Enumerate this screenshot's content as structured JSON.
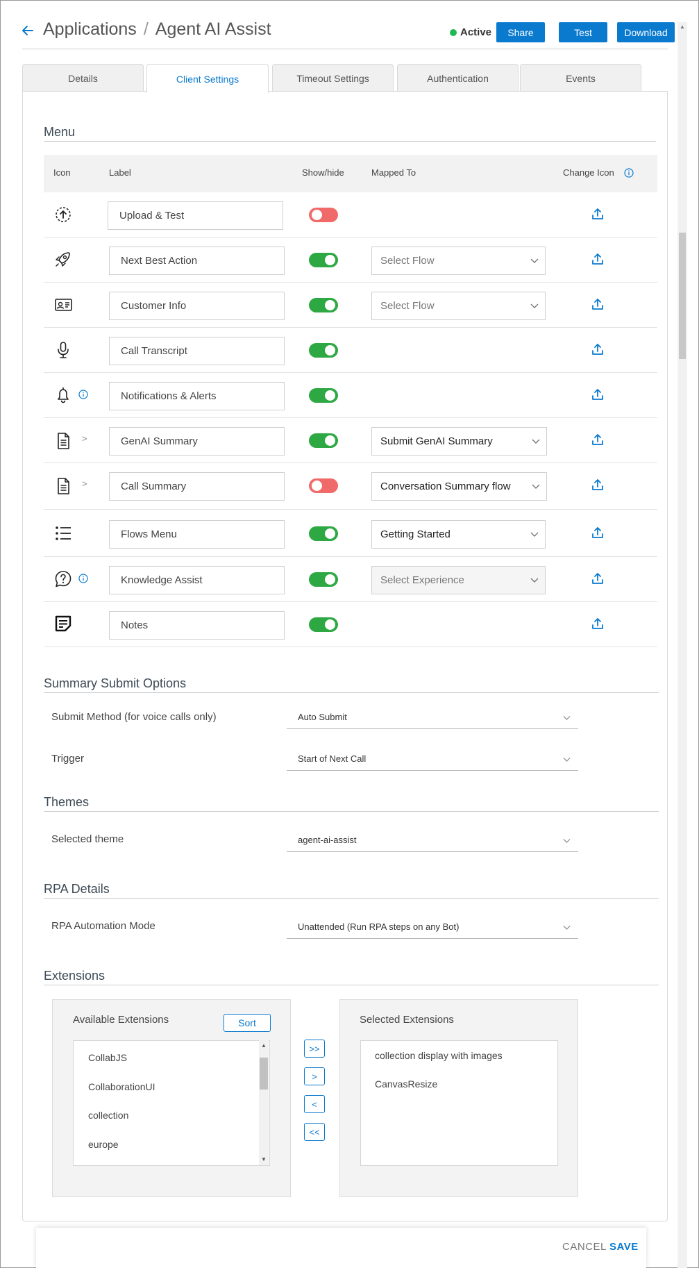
{
  "header": {
    "breadcrumb_root": "Applications",
    "breadcrumb_separator": "/",
    "breadcrumb_current": "Agent AI Assist",
    "status": "Active",
    "share_label": "Share",
    "test_label": "Test",
    "download_label": "Download"
  },
  "tabs": [
    "Details",
    "Client Settings",
    "Timeout Settings",
    "Authentication",
    "Events"
  ],
  "active_tab": "Client Settings",
  "menu": {
    "title": "Menu",
    "columns": {
      "icon": "Icon",
      "label": "Label",
      "show_hide": "Show/hide",
      "mapped_to": "Mapped To",
      "change_icon": "Change Icon"
    },
    "rows": [
      {
        "icon": "upload-circle-icon",
        "label": "Upload & Test",
        "shown": false,
        "mapped_to": null
      },
      {
        "icon": "rocket-icon",
        "label": "Next Best Action",
        "shown": true,
        "mapped_to": "Select Flow"
      },
      {
        "icon": "id-card-icon",
        "label": "Customer Info",
        "shown": true,
        "mapped_to": "Select Flow"
      },
      {
        "icon": "microphone-icon",
        "label": "Call Transcript",
        "shown": true,
        "mapped_to": null
      },
      {
        "icon": "bell-icon",
        "label": "Notifications & Alerts",
        "shown": true,
        "mapped_to": null
      },
      {
        "icon": "document-icon",
        "label": "GenAI Summary",
        "shown": true,
        "mapped_to": "Submit GenAI Summary"
      },
      {
        "icon": "document-icon",
        "label": "Call Summary",
        "shown": false,
        "mapped_to": "Conversation Summary flow"
      },
      {
        "icon": "list-icon",
        "label": "Flows Menu",
        "shown": true,
        "mapped_to": "Getting Started"
      },
      {
        "icon": "question-bubble-icon",
        "label": "Knowledge Assist",
        "shown": true,
        "mapped_to": "Select Experience"
      },
      {
        "icon": "note-icon",
        "label": "Notes",
        "shown": true,
        "mapped_to": null
      }
    ],
    "expander_glyph": ">"
  },
  "summary_submit": {
    "title": "Summary Submit Options",
    "submit_method_label": "Submit Method (for voice calls only)",
    "submit_method_value": "Auto Submit",
    "trigger_label": "Trigger",
    "trigger_value": "Start of Next Call"
  },
  "themes": {
    "title": "Themes",
    "selected_theme_label": "Selected theme",
    "selected_theme_value": "agent-ai-assist"
  },
  "rpa": {
    "title": "RPA Details",
    "mode_label": "RPA Automation Mode",
    "mode_value": "Unattended (Run RPA steps on any Bot)"
  },
  "extensions": {
    "title": "Extensions",
    "available_title": "Available Extensions",
    "sort_label": "Sort",
    "available": [
      "CollabJS",
      "CollaborationUI",
      "collection",
      "europe"
    ],
    "selected_title": "Selected Extensions",
    "selected": [
      "collection display with images",
      "CanvasResize"
    ],
    "move_all_right": ">>",
    "move_right": ">",
    "move_left": "<",
    "move_all_left": "<<"
  },
  "footer": {
    "cancel_label": "CANCEL",
    "save_label": "SAVE"
  },
  "colors": {
    "accent": "#0a7acf",
    "toggle_on": "#2ea843",
    "toggle_off": "#f16a6a",
    "status_active": "#1db954"
  }
}
